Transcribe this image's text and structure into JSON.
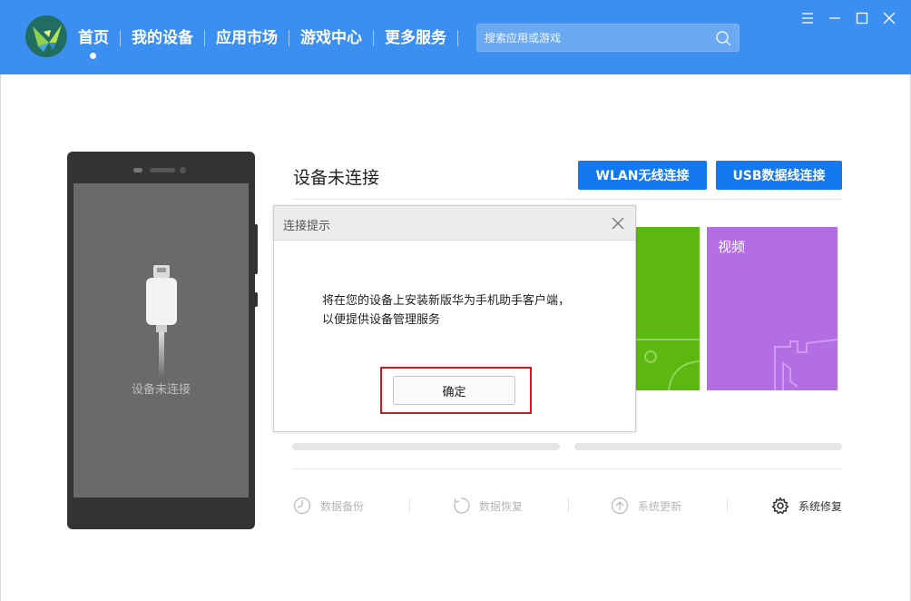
{
  "header": {
    "nav": [
      "首页",
      "我的设备",
      "应用市场",
      "游戏中心",
      "更多服务"
    ],
    "active_nav": "首页",
    "search_placeholder": "搜索应用或游戏"
  },
  "window_controls": [
    "menu-icon",
    "minimize-icon",
    "maximize-icon",
    "close-icon"
  ],
  "phone": {
    "status": "设备未连接"
  },
  "main": {
    "title": "设备未连接",
    "wlan_button": "WLAN无线连接",
    "usb_button": "USB数据线连接",
    "tiles": [
      {
        "label": "",
        "color": "#5cb711"
      },
      {
        "label": "视频",
        "color": "#b36ee3"
      }
    ],
    "tools": [
      {
        "label": "数据备份",
        "icon": "backup-icon"
      },
      {
        "label": "数据恢复",
        "icon": "restore-icon"
      },
      {
        "label": "系统更新",
        "icon": "update-icon"
      },
      {
        "label": "系统修复",
        "icon": "gear-icon"
      }
    ]
  },
  "dialog": {
    "title": "连接提示",
    "message_line1": "将在您的设备上安装新版华为手机助手客户端，",
    "message_line2": "以便提供设备管理服务",
    "ok": "确定"
  },
  "colors": {
    "accent": "#1479f0",
    "header": "#3b8ff0",
    "highlight": "#d9161d"
  }
}
